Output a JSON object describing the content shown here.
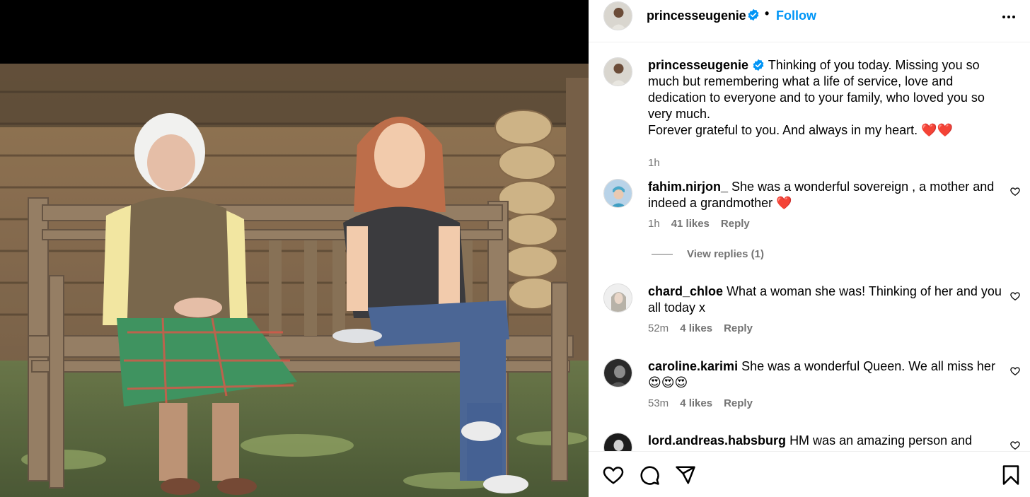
{
  "post": {
    "username": "princesseugenie",
    "separator": "•",
    "follow_label": "Follow"
  },
  "caption": {
    "username": "princesseugenie",
    "text_line1": "Thinking of you today. Missing you so much but remembering what a life of service, love and dedication to everyone and to your family, who loved you so very much.",
    "text_line2": "Forever grateful to you. And always in my heart. ❤️❤️",
    "time": "1h"
  },
  "comments": [
    {
      "username": "fahim.nirjon_",
      "text": "She was a wonderful sovereign , a mother and indeed a grandmother ❤️",
      "time": "1h",
      "likes": "41 likes",
      "reply_label": "Reply"
    },
    {
      "username": "chard_chloe",
      "text": "What a woman she was! Thinking of her and you all today x",
      "time": "52m",
      "likes": "4 likes",
      "reply_label": "Reply"
    },
    {
      "username": "caroline.karimi",
      "text": "She was a wonderful Queen. We all miss her 😍😍😍",
      "time": "53m",
      "likes": "4 likes",
      "reply_label": "Reply"
    },
    {
      "username": "lord.andreas.habsburg",
      "text": "HM was an amazing person and"
    }
  ],
  "view_replies_label": "View replies (1)",
  "icons": {
    "verified": "verified-badge-icon",
    "more": "more-options-icon",
    "like": "heart-icon",
    "comment": "comment-icon",
    "share": "share-icon",
    "save": "bookmark-icon"
  },
  "colors": {
    "accent": "#0095f6",
    "verified": "#0095f6",
    "secondary_text": "#737373"
  }
}
